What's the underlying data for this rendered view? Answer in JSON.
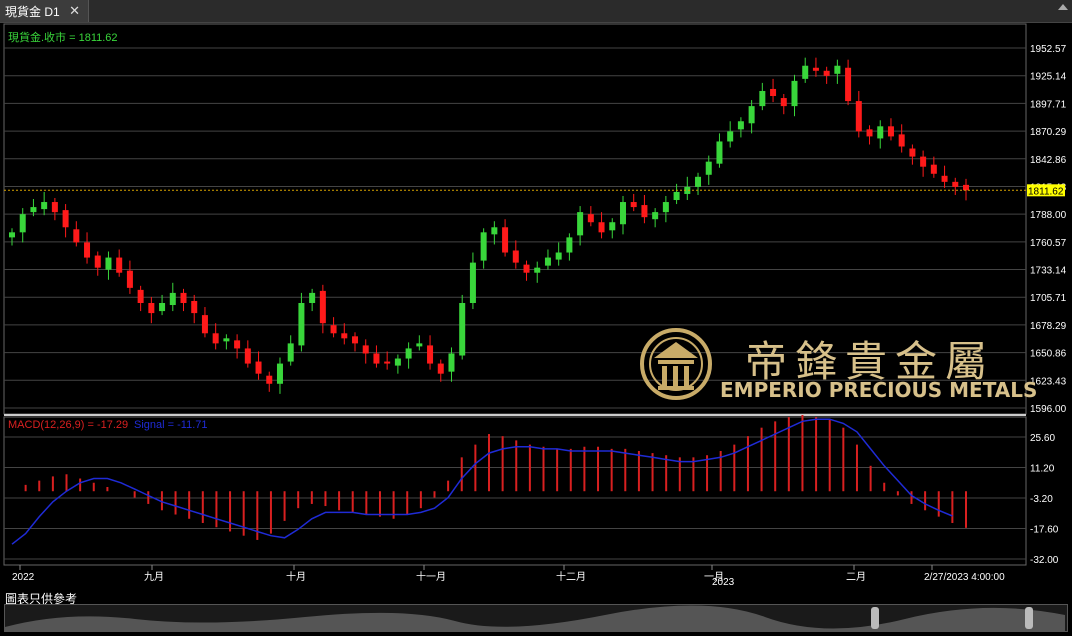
{
  "tab": {
    "title": "現貨金 D1",
    "close": "✕"
  },
  "price_panel": {
    "label": "現貨金.收市 = 1811.62",
    "last_price": "1811.62"
  },
  "macd_panel": {
    "label_macd": "MACD(12,26,9) = -17.29",
    "label_signal": "Signal = -11.71"
  },
  "footer_note": "圖表只供參考",
  "logo": {
    "cn": "帝鋒貴金屬",
    "en": "EMPERIO PRECIOUS METALS"
  },
  "colors": {
    "up": "#39d63b",
    "down": "#ff1a1a",
    "macd_hist": "#d92020",
    "signal": "#1f2bd6",
    "axis_text": "#ffffff",
    "last_price_bg": "#ffff00"
  },
  "chart_data": [
    {
      "type": "candlestick",
      "ylim": [
        1596.0,
        1952.57
      ],
      "price_ticks": [
        "1952.57",
        "1925.14",
        "1897.71",
        "1870.29",
        "1842.86",
        "1815.43",
        "1788.00",
        "1760.57",
        "1733.14",
        "1705.71",
        "1678.29",
        "1650.86",
        "1623.43",
        "1596.00"
      ],
      "time_labels": [
        "2022",
        "九月",
        "十月",
        "十一月",
        "十二月",
        "一月",
        "二月",
        "2/27/2023 4:00:00"
      ],
      "time_sub_label": "2023",
      "close_path": [
        1770,
        1788,
        1795,
        1800,
        1790,
        1775,
        1760,
        1745,
        1735,
        1745,
        1730,
        1715,
        1700,
        1690,
        1700,
        1710,
        1700,
        1690,
        1670,
        1660,
        1665,
        1655,
        1640,
        1630,
        1620,
        1640,
        1660,
        1700,
        1710,
        1680,
        1670,
        1665,
        1660,
        1650,
        1640,
        1640,
        1645,
        1655,
        1660,
        1640,
        1630,
        1650,
        1700,
        1740,
        1770,
        1775,
        1750,
        1740,
        1730,
        1735,
        1745,
        1750,
        1765,
        1790,
        1780,
        1770,
        1780,
        1800,
        1795,
        1785,
        1790,
        1800,
        1810,
        1815,
        1825,
        1840,
        1860,
        1870,
        1880,
        1895,
        1910,
        1905,
        1895,
        1920,
        1935,
        1930,
        1925,
        1935,
        1900,
        1870,
        1865,
        1875,
        1865,
        1855,
        1845,
        1835,
        1828,
        1820,
        1815,
        1811.62
      ]
    },
    {
      "type": "bar+line",
      "ylim": [
        -32.0,
        25.6
      ],
      "macd_ticks": [
        "25.60",
        "11.20",
        "-3.20",
        "-17.60",
        "-32.00"
      ],
      "histogram": [
        0,
        3,
        5,
        7,
        8,
        6,
        4,
        2,
        0,
        -3,
        -6,
        -9,
        -11,
        -13,
        -15,
        -17,
        -19,
        -21,
        -23,
        -20,
        -14,
        -8,
        -6,
        -7,
        -9,
        -10,
        -11,
        -12,
        -13,
        -11,
        -8,
        -3,
        5,
        16,
        22,
        27,
        26,
        24,
        22,
        21,
        20,
        20,
        21,
        21,
        20,
        20,
        19,
        18,
        17,
        16,
        16,
        17,
        19,
        22,
        26,
        30,
        33,
        35,
        36,
        35,
        34,
        30,
        22,
        12,
        4,
        -2,
        -6,
        -9,
        -12,
        -15,
        -17.29
      ],
      "signal": [
        -25,
        -20,
        -12,
        -5,
        0,
        4,
        6,
        6,
        4,
        1,
        -2,
        -5,
        -7,
        -9,
        -11,
        -13,
        -15,
        -17,
        -19,
        -21,
        -22,
        -18,
        -13,
        -10,
        -10,
        -10,
        -11,
        -11,
        -11,
        -11,
        -10,
        -8,
        -3,
        6,
        13,
        18,
        20,
        21,
        21,
        20,
        20,
        19,
        19,
        19,
        19,
        18,
        17,
        16,
        15,
        14,
        14,
        15,
        16,
        18,
        21,
        24,
        27,
        30,
        33,
        34,
        34,
        32,
        28,
        20,
        12,
        5,
        -2,
        -6,
        -9,
        -11.71
      ]
    }
  ]
}
